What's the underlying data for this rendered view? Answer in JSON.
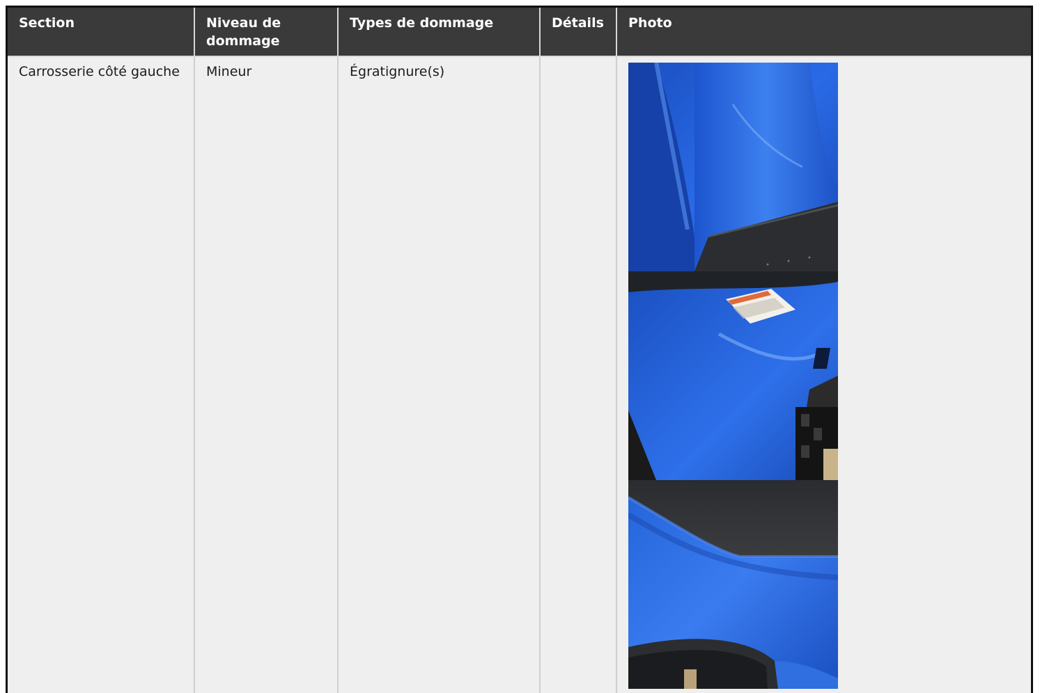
{
  "table": {
    "headers": {
      "section": "Section",
      "niveau": "Niveau de dommage",
      "types": "Types de dommage",
      "details": "Détails",
      "photo": "Photo"
    },
    "rows": [
      {
        "section": "Carrosserie côté gauche",
        "niveau": "Mineur",
        "types": "Égratignure(s)",
        "details": "",
        "photos": [
          "blue-fender-photo",
          "blue-panel-decal-photo",
          "blue-side-panel-seat-photo"
        ]
      }
    ]
  },
  "colors": {
    "header_bg": "#3a3a3a",
    "header_text": "#ffffff",
    "cell_bg": "#efefef",
    "body_blue": "#1f5fd1"
  }
}
